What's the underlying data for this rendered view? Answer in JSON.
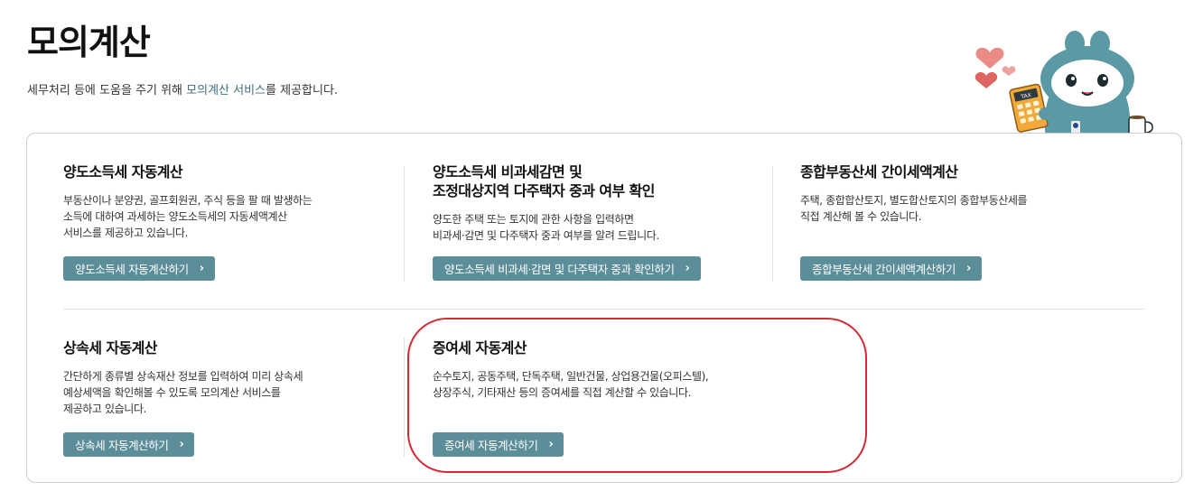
{
  "page": {
    "title": "모의계산",
    "desc_before": "세무처리 등에 도움을 주기 위해 ",
    "desc_highlight": "모의계산 서비스",
    "desc_after": "를 제공합니다."
  },
  "mascot": {
    "calculator_label": "TAX"
  },
  "cards": [
    {
      "title_lines": [
        "양도소득세 자동계산"
      ],
      "desc_lines": [
        "부동산이나 분양권, 골프회원권, 주식 등을 팔 때 발생하는",
        "소득에 대하여 과세하는 양도소득세의 자동세액계산",
        "서비스를 제공하고 있습니다."
      ],
      "button": "양도소득세 자동계산하기"
    },
    {
      "title_lines": [
        "양도소득세 비과세감면 및",
        "조정대상지역 다주택자 중과 여부 확인"
      ],
      "desc_lines": [
        "양도한 주택 또는 토지에 관한 사항을 입력하면",
        "비과세·감면 및 다주택자 중과 여부를 알려 드립니다."
      ],
      "button": "양도소득세 비과세·감면 및 다주택자 중과 확인하기"
    },
    {
      "title_lines": [
        "종합부동산세 간이세액계산"
      ],
      "desc_lines": [
        "주택, 종합합산토지, 별도합산토지의 종합부동산세를",
        "직접 계산해 볼 수 있습니다."
      ],
      "button": "종합부동산세 간이세액계산하기"
    },
    {
      "title_lines": [
        "상속세 자동계산"
      ],
      "desc_lines": [
        "간단하게 종류별 상속재산 정보를 입력하여 미리 상속세",
        "예상세액을 확인해볼 수 있도록 모의계산 서비스를",
        "제공하고 있습니다."
      ],
      "button": "상속세 자동계산하기"
    },
    {
      "title_lines": [
        "증여세 자동계산"
      ],
      "desc_lines": [
        "순수토지, 공동주택, 단독주택, 일반건물, 상업용건물(오피스텔),",
        "상장주식, 기타재산 등의 증여세를 직접 계산할 수 있습니다."
      ],
      "button": "증여세 자동계산하기"
    }
  ],
  "colors": {
    "button_bg": "#5b8e99",
    "highlight_ring": "#d42a34",
    "mascot_body": "#5b9aa5"
  }
}
